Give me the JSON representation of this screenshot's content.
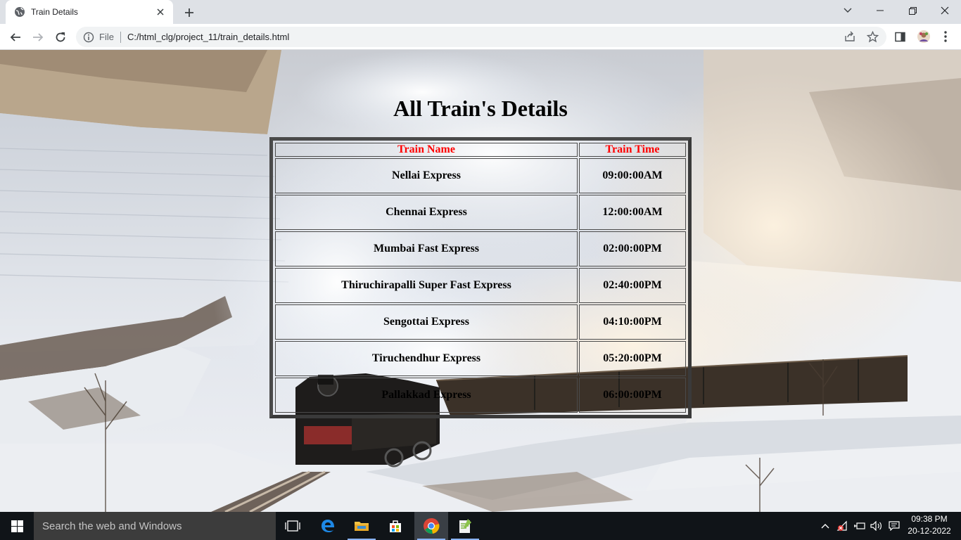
{
  "browser": {
    "tab_title": "Train Details",
    "omnibox_scheme": "File",
    "url": "C:/html_clg/project_11/train_details.html"
  },
  "page": {
    "title": "All Train's Details",
    "table": {
      "headers": [
        "Train Name",
        "Train Time"
      ],
      "rows": [
        [
          "Nellai Express",
          "09:00:00AM"
        ],
        [
          "Chennai Express",
          "12:00:00AM"
        ],
        [
          "Mumbai Fast Express",
          "02:00:00PM"
        ],
        [
          "Thiruchirapalli Super Fast Express",
          "02:40:00PM"
        ],
        [
          "Sengottai Express",
          "04:10:00PM"
        ],
        [
          "Tiruchendhur Express",
          "05:20:00PM"
        ],
        [
          "Pallakkad Express",
          "06:00:00PM"
        ]
      ]
    },
    "colors": {
      "header_text": "#ff0000",
      "table_border": "#4a4a4a"
    }
  },
  "taskbar": {
    "search_placeholder": "Search the web and Windows",
    "time": "09:38 PM",
    "date": "20-12-2022"
  }
}
